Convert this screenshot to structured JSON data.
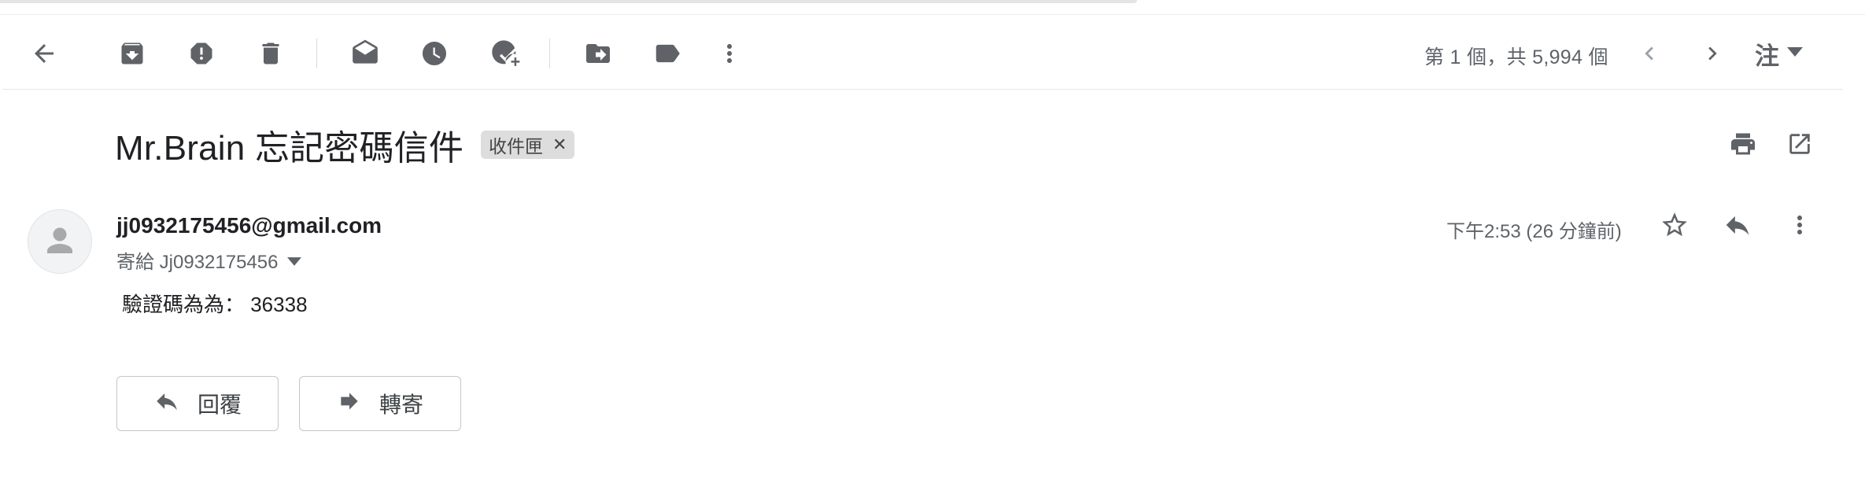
{
  "toolbar": {
    "icons": [
      "back-arrow-icon",
      "archive-icon",
      "report-spam-icon",
      "delete-icon",
      "mark-unread-icon",
      "snooze-icon",
      "add-to-tasks-icon",
      "move-to-icon",
      "label-icon",
      "more-vert-icon"
    ],
    "pager_text": "第 1 個，共 5,994 個",
    "input_tool_label": "注"
  },
  "message": {
    "subject": "Mr.Brain 忘記密碼信件",
    "label": "收件匣",
    "sender": "jj0932175456@gmail.com",
    "to_line": "寄給 Jj0932175456",
    "time": "下午2:53 (26 分鐘前)",
    "body": "驗證碼為為： 36338"
  },
  "actions": {
    "reply_label": "回覆",
    "forward_label": "轉寄"
  },
  "colors": {
    "icon": "#5f6368",
    "text": "#202124",
    "chip_bg": "#dddddd"
  }
}
